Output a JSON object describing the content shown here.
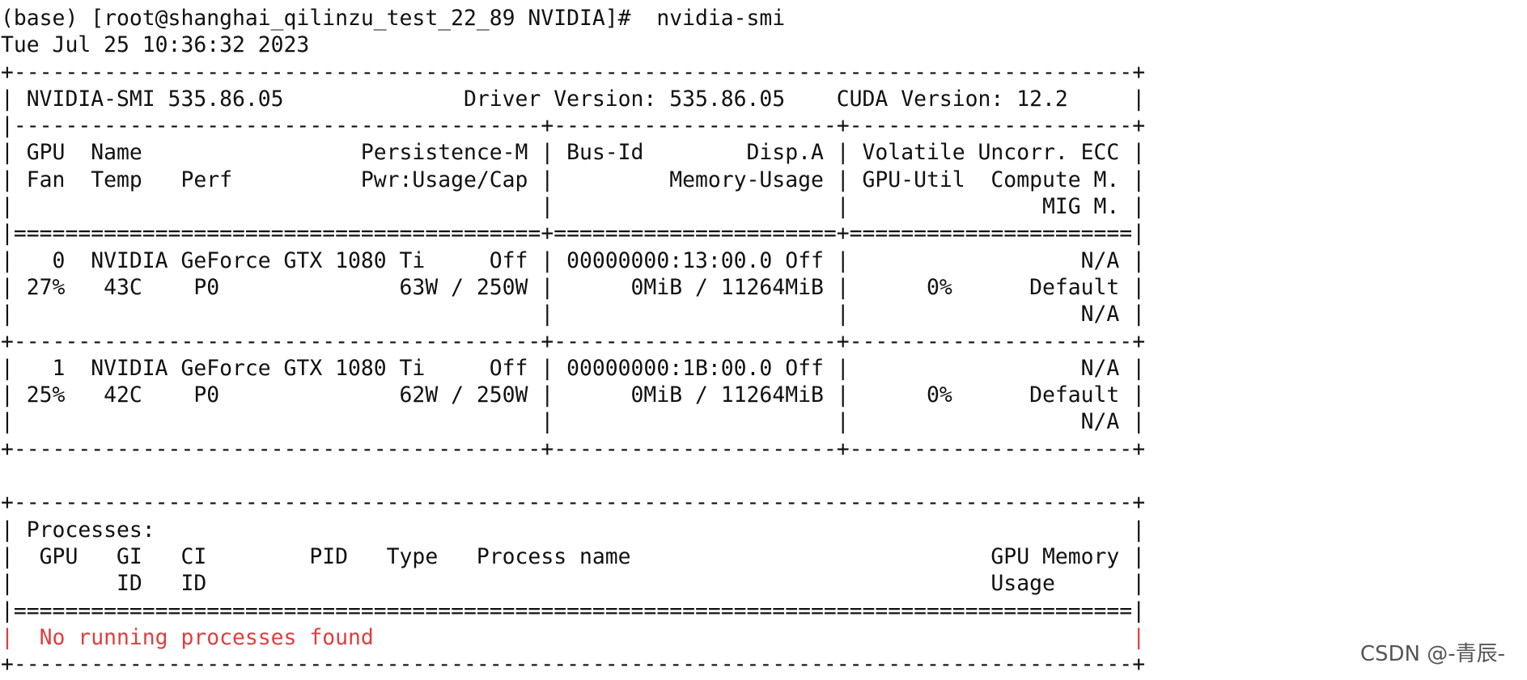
{
  "terminal": {
    "lines": [
      "(base) [root@shanghai_qilinzu_test_22_89 NVIDIA]#  nvidia-smi",
      "Tue Jul 25 10:36:32 2023",
      "+---------------------------------------------------------------------------------------+",
      "| NVIDIA-SMI 535.86.05              Driver Version: 535.86.05    CUDA Version: 12.2     |",
      "|-----------------------------------------+----------------------+----------------------+",
      "| GPU  Name                 Persistence-M | Bus-Id        Disp.A | Volatile Uncorr. ECC |",
      "| Fan  Temp   Perf          Pwr:Usage/Cap |         Memory-Usage | GPU-Util  Compute M. |",
      "|                                         |                      |               MIG M. |",
      "|=========================================+======================+======================|",
      "|   0  NVIDIA GeForce GTX 1080 Ti     Off | 00000000:13:00.0 Off |                  N/A |",
      "| 27%   43C    P0              63W / 250W |      0MiB / 11264MiB |      0%      Default |",
      "|                                         |                      |                  N/A |",
      "+-----------------------------------------+----------------------+----------------------+",
      "|   1  NVIDIA GeForce GTX 1080 Ti     Off | 00000000:1B:00.0 Off |                  N/A |",
      "| 25%   42C    P0              62W / 250W |      0MiB / 11264MiB |      0%      Default |",
      "|                                         |                      |                  N/A |",
      "+-----------------------------------------+----------------------+----------------------+",
      "",
      "+---------------------------------------------------------------------------------------+",
      "| Processes:                                                                            |",
      "|  GPU   GI   CI        PID   Type   Process name                            GPU Memory |",
      "|        ID   ID                                                             Usage      |",
      "|=======================================================================================|",
      "|  No running processes found                                                           |",
      "+---------------------------------------------------------------------------------------+"
    ],
    "error_line_index": 23
  },
  "watermark": {
    "text": "CSDN @-青辰-"
  },
  "colors": {
    "background": "#ffffff",
    "text": "#111111",
    "error_text": "#e03e3e",
    "watermark": "#555555"
  }
}
